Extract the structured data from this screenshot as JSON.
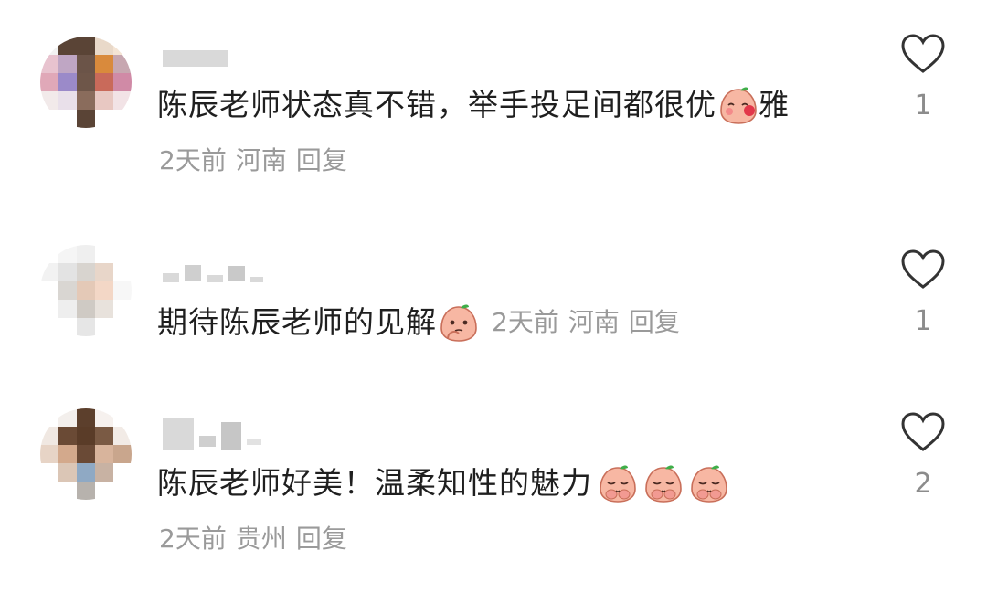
{
  "comments": [
    {
      "text": "陈辰老师状态真不错，举手投足间都很优",
      "text_after_emoji": "雅",
      "emoji": "blush-cover-mouth-emoji",
      "date": "2天前",
      "location": "河南",
      "reply": "回复",
      "likes": "1"
    },
    {
      "text": "期待陈辰老师的见解",
      "emoji": "thinking-emoji",
      "date": "2天前",
      "location": "河南",
      "reply": "回复",
      "likes": "1"
    },
    {
      "text": "陈辰老师好美！温柔知性的魅力",
      "emoji": "shy-hands-emoji",
      "emoji_repeat": 3,
      "date": "2天前",
      "location": "贵州",
      "reply": "回复",
      "likes": "2"
    }
  ],
  "colors": {
    "meta_text": "#9a9a9a",
    "heart_outline": "#333333",
    "emoji_fill": "#f7b7a3",
    "emoji_leaf": "#3fae49"
  },
  "icons": {
    "like": "heart-outline-icon"
  }
}
